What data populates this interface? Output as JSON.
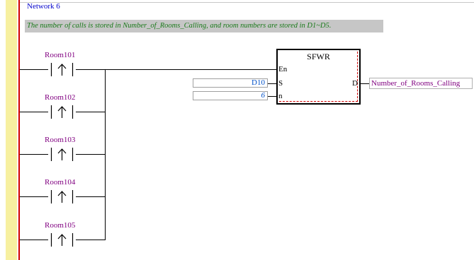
{
  "network": {
    "title": "Network 6",
    "comment": "The number of calls is stored in Number_of_Rooms_Calling, and room numbers are stored in D1~D5."
  },
  "contacts": [
    {
      "label": "Room101",
      "type": "rising-edge"
    },
    {
      "label": "Room102",
      "type": "rising-edge"
    },
    {
      "label": "Room103",
      "type": "rising-edge"
    },
    {
      "label": "Room104",
      "type": "rising-edge"
    },
    {
      "label": "Room105",
      "type": "rising-edge"
    }
  ],
  "function_block": {
    "name": "SFWR",
    "pins": {
      "en": "En",
      "s": "S",
      "n": "n",
      "d": "D"
    },
    "inputs": {
      "s_value": "D10",
      "n_value": "6"
    },
    "output": "Number_of_Rooms_Calling"
  },
  "colors": {
    "left_rail": "#f7f0a0",
    "power_rail": "#d00000",
    "contact_label": "#800080",
    "operand": "#0050c8",
    "comment_text": "#1a7a1a",
    "network_title": "#0000cc"
  }
}
